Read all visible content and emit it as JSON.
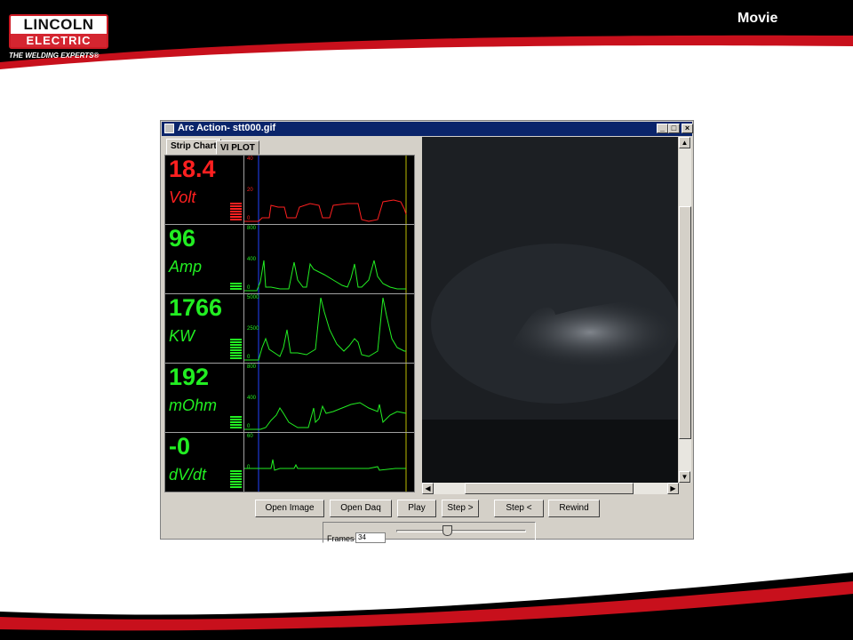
{
  "slide": {
    "title": "Movie",
    "logo": {
      "line1": "LINCOLN",
      "line2": "ELECTRIC",
      "tagline": "THE WELDING EXPERTS®"
    },
    "colors": {
      "brand_red": "#d42530",
      "header_bg": "#000000"
    }
  },
  "window": {
    "title": "Arc Action- stt000.gif",
    "controls": {
      "minimize": "_",
      "maximize": "□",
      "close": "×"
    },
    "tabs": [
      {
        "label": "Strip Chart",
        "active": true
      },
      {
        "label": "VI PLOT",
        "active": false
      }
    ],
    "readouts": [
      {
        "value": "18.4",
        "unit": "Volt",
        "color": "#ff2020",
        "scale_max": "40",
        "scale_mid": "20",
        "scale_min": "0"
      },
      {
        "value": "96",
        "unit": "Amp",
        "color": "#22ee22",
        "scale_max": "800",
        "scale_mid": "400",
        "scale_min": "0"
      },
      {
        "value": "1766",
        "unit": "KW",
        "color": "#22ee22",
        "scale_max": "5000",
        "scale_mid": "2500",
        "scale_min": "0"
      },
      {
        "value": "192",
        "unit": "mOhm",
        "color": "#22ee22",
        "scale_max": "800",
        "scale_mid": "400",
        "scale_min": "0"
      },
      {
        "value": "-0",
        "unit": "dV/dt",
        "color": "#22ee22",
        "scale_max": "60",
        "scale_mid": "0",
        "scale_min": ""
      }
    ],
    "buttons": [
      "Open Image",
      "Open Daq",
      "Play",
      "Step >",
      "Step <",
      "Rewind"
    ],
    "frames": {
      "label": "Frames",
      "value": "34"
    },
    "scroll": {
      "up": "▲",
      "down": "▼",
      "left": "◀",
      "right": "▶"
    }
  }
}
